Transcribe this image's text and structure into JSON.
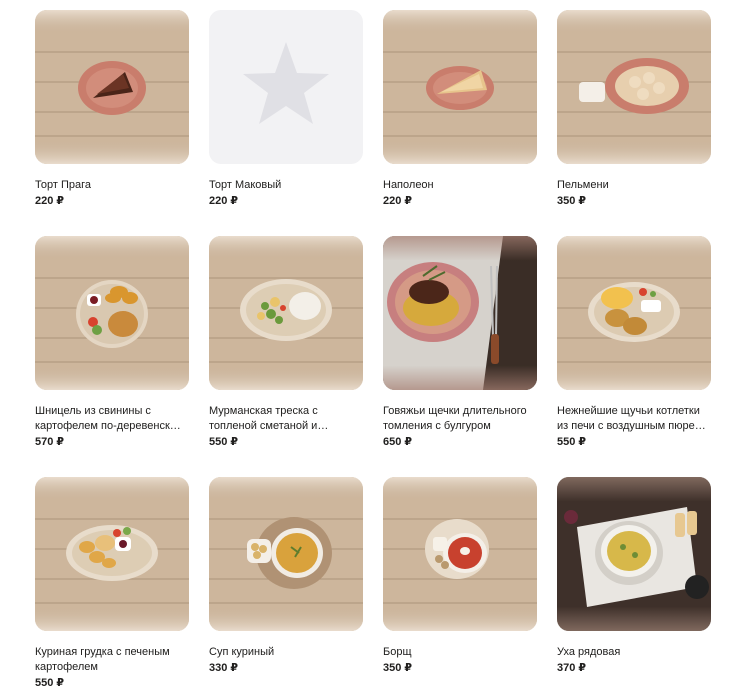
{
  "currency": "₽",
  "products": [
    {
      "title": "Торт Прага",
      "price": "220 ₽",
      "image": "cake-chocolate"
    },
    {
      "title": "Торт Маковый",
      "price": "220 ₽",
      "image": "star-placeholder-icon"
    },
    {
      "title": "Наполеон",
      "price": "220 ₽",
      "image": "cake-napoleon"
    },
    {
      "title": "Пельмени",
      "price": "350 ₽",
      "image": "dumplings"
    },
    {
      "title": "Шницель из свинины с картофелем по-деревенски и…",
      "price": "570 ₽",
      "image": "schnitzel-potatoes"
    },
    {
      "title": "Мурманская треска с топленой сметаной и жаренными…",
      "price": "550 ₽",
      "image": "cod-vegetables"
    },
    {
      "title": "Говяжьи щечки длительного томления с булгуром",
      "price": "650 ₽",
      "image": "beef-cheeks-bulgur"
    },
    {
      "title": "Нежнейшие щучьи котлетки из печи с воздушным пюре и…",
      "price": "550 ₽",
      "image": "pike-cutlets-puree"
    },
    {
      "title": "Куриная грудка с печеным картофелем",
      "price": "550 ₽",
      "image": "chicken-breast-potatoes"
    },
    {
      "title": "Суп куриный",
      "price": "330 ₽",
      "image": "chicken-soup"
    },
    {
      "title": "Борщ",
      "price": "350 ₽",
      "image": "borscht"
    },
    {
      "title": "Уха рядовая",
      "price": "370 ₽",
      "image": "fish-soup"
    }
  ]
}
